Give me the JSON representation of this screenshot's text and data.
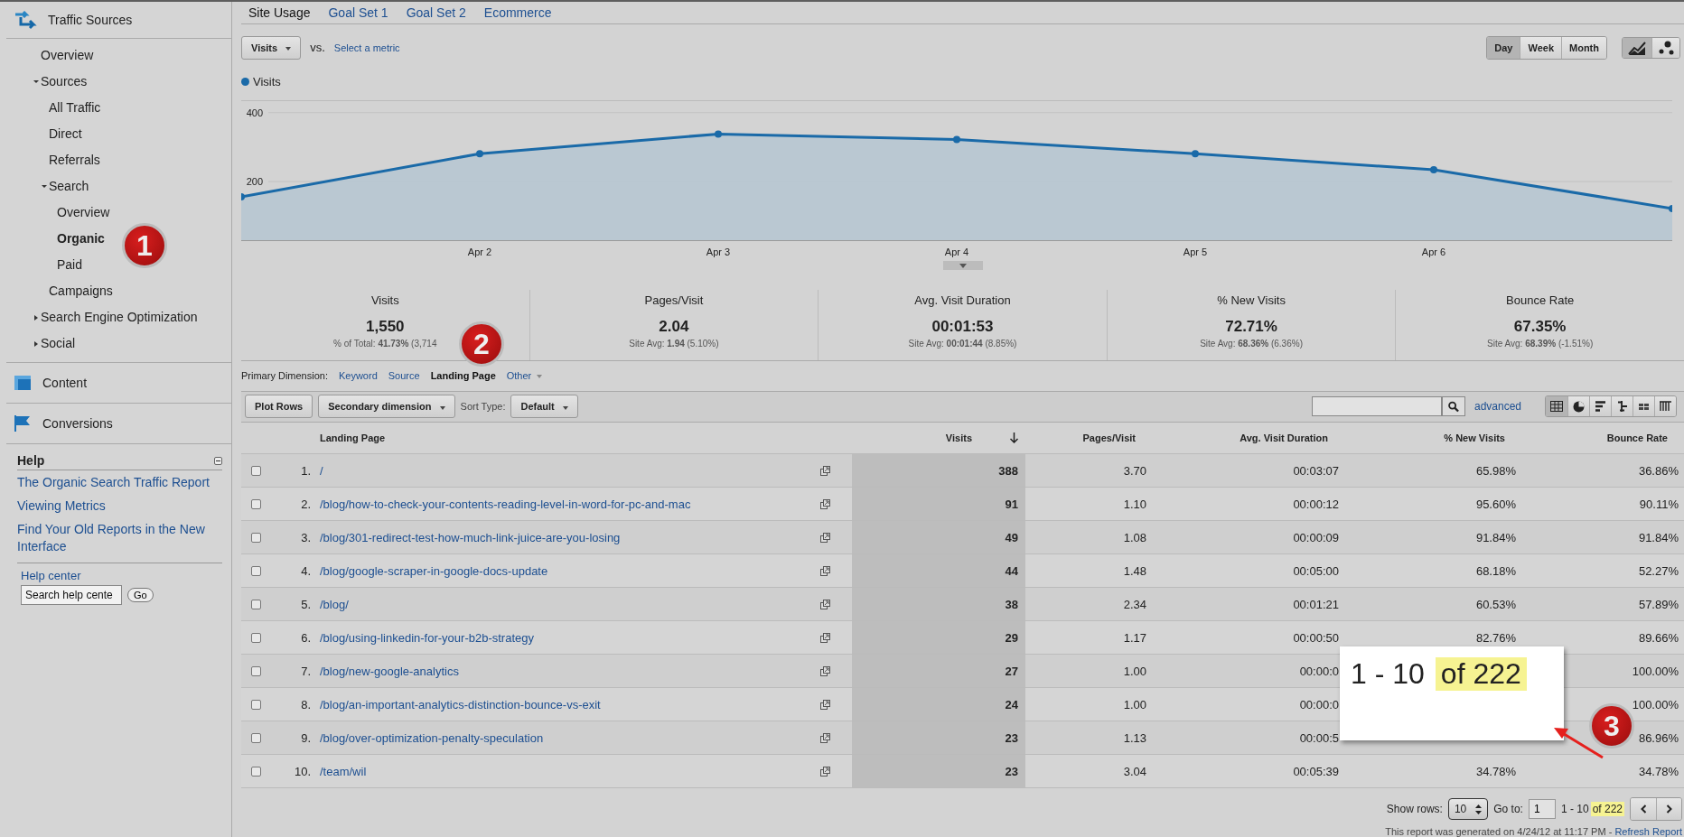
{
  "sidebar": {
    "title": "Traffic Sources",
    "nav": {
      "items": [
        {
          "label": "Overview",
          "selected": false
        },
        {
          "label": "Sources",
          "expanded": true,
          "selected": false,
          "children": [
            {
              "label": "All Traffic",
              "selected": false
            },
            {
              "label": "Direct",
              "selected": false
            },
            {
              "label": "Referrals",
              "selected": false
            },
            {
              "label": "Search",
              "expanded": true,
              "selected": false,
              "children": [
                {
                  "label": "Overview",
                  "selected": false
                },
                {
                  "label": "Organic",
                  "selected": true
                },
                {
                  "label": "Paid",
                  "selected": false
                }
              ]
            },
            {
              "label": "Campaigns",
              "selected": false
            }
          ]
        },
        {
          "label": "Search Engine Optimization",
          "expanded": false,
          "selected": false
        },
        {
          "label": "Social",
          "expanded": false,
          "selected": false
        }
      ]
    },
    "sections": [
      {
        "kind": "content",
        "label": "Content"
      },
      {
        "kind": "conversions",
        "label": "Conversions"
      }
    ],
    "help": {
      "title": "Help",
      "links": [
        "The Organic Search Traffic Report",
        "Viewing Metrics",
        "Find Your Old Reports in the New Interface"
      ],
      "center_label": "Help center",
      "search_value": "Search help cente",
      "go": "Go"
    }
  },
  "report_tabs": [
    {
      "label": "Site Usage",
      "selected": true
    },
    {
      "label": "Goal Set 1",
      "selected": false
    },
    {
      "label": "Goal Set 2",
      "selected": false
    },
    {
      "label": "Ecommerce",
      "selected": false
    }
  ],
  "metric": {
    "value": "Visits",
    "vs": "vs.",
    "compare_link": "Select a metric"
  },
  "granularity": [
    {
      "label": "Day",
      "selected": true
    },
    {
      "label": "Week",
      "selected": false
    },
    {
      "label": "Month",
      "selected": false
    }
  ],
  "chart_types": [
    {
      "kind": "line",
      "selected": true
    },
    {
      "kind": "motion",
      "selected": false
    }
  ],
  "chart": {
    "chart_data": {
      "type": "area",
      "categories": [
        null,
        "Apr 2",
        "Apr 3",
        "Apr 4",
        "Apr 5",
        "Apr 6",
        null
      ],
      "ylim": [
        30,
        436
      ],
      "yticks": [
        200,
        400
      ],
      "series": [
        {
          "name": "Visits",
          "color": "#1a6aa8",
          "values": [
            156,
            281,
            338,
            322,
            281,
            234,
            122
          ]
        }
      ]
    }
  },
  "scorecards": [
    {
      "label": "Visits",
      "value": "1,550",
      "note": "% of Total: **41.73%** (3,714"
    },
    {
      "label": "Pages/Visit",
      "value": "2.04",
      "note": "Site Avg: **1.94** (5.10%)"
    },
    {
      "label": "Avg. Visit Duration",
      "value": "00:01:53",
      "note": "Site Avg: **00:01:44** (8.85%)"
    },
    {
      "label": "% New Visits",
      "value": "72.71%",
      "note": "Site Avg: **68.36%** (6.36%)"
    },
    {
      "label": "Bounce Rate",
      "value": "67.35%",
      "note": "Site Avg: **68.39%** (-1.51%)"
    }
  ],
  "primary_dimension": {
    "label": "Primary Dimension:",
    "options": [
      {
        "label": "Keyword",
        "selected": false
      },
      {
        "label": "Source",
        "selected": false
      },
      {
        "label": "Landing Page",
        "selected": true
      },
      {
        "label": "Other",
        "selected": false
      }
    ]
  },
  "toolbar": {
    "plot_rows": "Plot Rows",
    "secondary": "Secondary dimension",
    "sort_label": "Sort Type:",
    "sort": "Default",
    "advanced": "advanced",
    "views": [
      {
        "kind": "table",
        "selected": true
      },
      {
        "kind": "pie",
        "selected": false
      },
      {
        "kind": "bars",
        "selected": false
      },
      {
        "kind": "comparison",
        "selected": false
      },
      {
        "kind": "pivot",
        "selected": false
      },
      {
        "kind": "grid",
        "selected": false
      }
    ]
  },
  "table": {
    "columns": [
      "Landing Page",
      "Visits",
      "Pages/Visit",
      "Avg. Visit Duration",
      "% New Visits",
      "Bounce Rate"
    ],
    "rows": [
      {
        "checked": false,
        "index": "1.",
        "page": "/",
        "visits": "388",
        "pages_visit": "3.70",
        "duration": "00:03:07",
        "new_visits": "65.98%",
        "bounce": "36.86%"
      },
      {
        "checked": false,
        "index": "2.",
        "page": "/blog/how-to-check-your-contents-reading-level-in-word-for-pc-and-mac",
        "visits": "91",
        "pages_visit": "1.10",
        "duration": "00:00:12",
        "new_visits": "95.60%",
        "bounce": "90.11%"
      },
      {
        "checked": false,
        "index": "3.",
        "page": "/blog/301-redirect-test-how-much-link-juice-are-you-losing",
        "visits": "49",
        "pages_visit": "1.08",
        "duration": "00:00:09",
        "new_visits": "91.84%",
        "bounce": "91.84%"
      },
      {
        "checked": false,
        "index": "4.",
        "page": "/blog/google-scraper-in-google-docs-update",
        "visits": "44",
        "pages_visit": "1.48",
        "duration": "00:05:00",
        "new_visits": "68.18%",
        "bounce": "52.27%"
      },
      {
        "checked": false,
        "index": "5.",
        "page": "/blog/",
        "visits": "38",
        "pages_visit": "2.34",
        "duration": "00:01:21",
        "new_visits": "60.53%",
        "bounce": "57.89%"
      },
      {
        "checked": false,
        "index": "6.",
        "page": "/blog/using-linkedin-for-your-b2b-strategy",
        "visits": "29",
        "pages_visit": "1.17",
        "duration": "00:00:50",
        "new_visits": "82.76%",
        "bounce": "89.66%"
      },
      {
        "checked": false,
        "index": "7.",
        "page": "/blog/new-google-analytics",
        "visits": "27",
        "pages_visit": "1.00",
        "duration": "00:00:0",
        "bounce": "100.00%"
      },
      {
        "checked": false,
        "index": "8.",
        "page": "/blog/an-important-analytics-distinction-bounce-vs-exit",
        "visits": "24",
        "pages_visit": "1.00",
        "duration": "00:00:0",
        "bounce": "100.00%"
      },
      {
        "checked": false,
        "index": "9.",
        "page": "/blog/over-optimization-penalty-speculation",
        "visits": "23",
        "pages_visit": "1.13",
        "duration": "00:00:5",
        "bounce": "86.96%"
      },
      {
        "checked": false,
        "index": "10.",
        "page": "/team/wil",
        "visits": "23",
        "pages_visit": "3.04",
        "duration": "00:05:39",
        "new_visits": "34.78%",
        "bounce": "34.78%"
      }
    ]
  },
  "pagination": {
    "show_rows_label": "Show rows:",
    "show_rows": "10",
    "goto_label": "Go to:",
    "goto": "1",
    "range": "1 - 10",
    "total": "of 222",
    "highlighted": true
  },
  "footer": {
    "text": "This report was generated on 4/24/12 at 11:17 PM - ",
    "link": "Refresh Report"
  },
  "callout": {
    "range": "1 - 10",
    "total": "of 222",
    "highlighted": true
  },
  "badges": [
    "1",
    "2",
    "3"
  ]
}
